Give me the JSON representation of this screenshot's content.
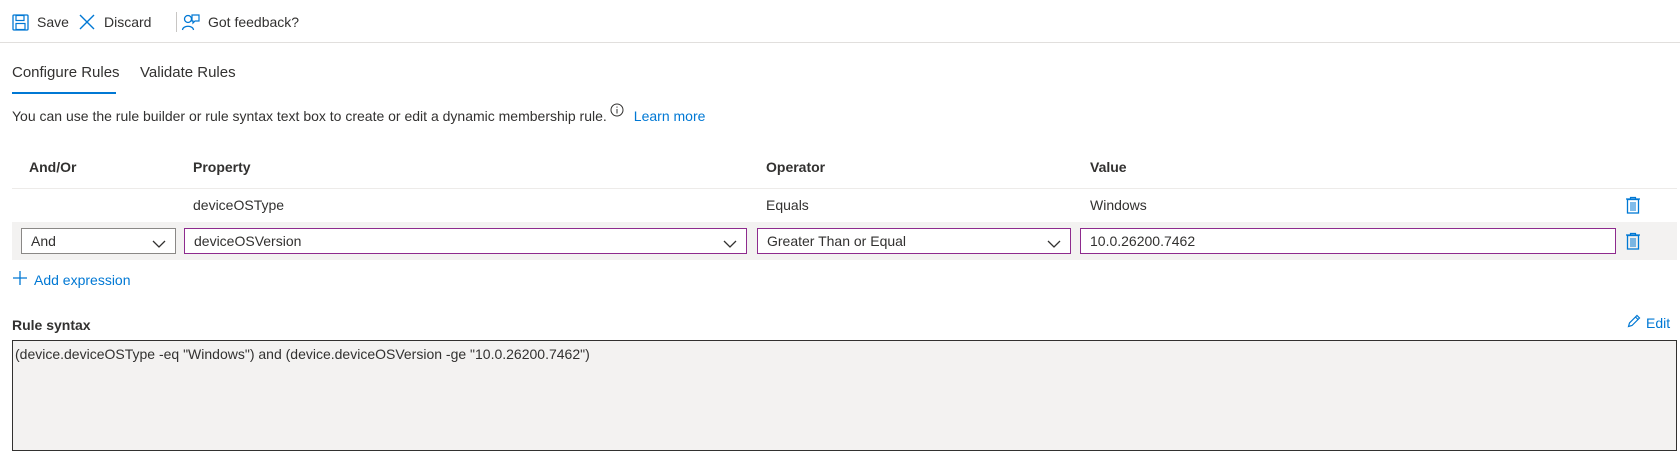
{
  "toolbar": {
    "save_label": "Save",
    "discard_label": "Discard",
    "feedback_label": "Got feedback?"
  },
  "tabs": [
    {
      "label": "Configure Rules",
      "active": true
    },
    {
      "label": "Validate Rules",
      "active": false
    }
  ],
  "description": {
    "text": "You can use the rule builder or rule syntax text box to create or edit a dynamic membership rule.",
    "learn_more": "Learn more"
  },
  "table": {
    "headers": [
      "And/Or",
      "Property",
      "Operator",
      "Value"
    ],
    "rows": [
      {
        "and_or": "",
        "property": "deviceOSType",
        "operator": "Equals",
        "value": "Windows"
      },
      {
        "and_or": "And",
        "property": "deviceOSVersion",
        "operator": "Greater Than or Equal",
        "value": "10.0.26200.7462"
      }
    ]
  },
  "add_expression_label": "Add expression",
  "rule_syntax": {
    "title": "Rule syntax",
    "edit_label": "Edit",
    "text": "(device.deviceOSType -eq \"Windows\") and (device.deviceOSVersion -ge \"10.0.26200.7462\")"
  },
  "colors": {
    "accent": "#0078d4",
    "focus_border": "#8e2b8e",
    "row_highlight": "#f3f2f1"
  }
}
